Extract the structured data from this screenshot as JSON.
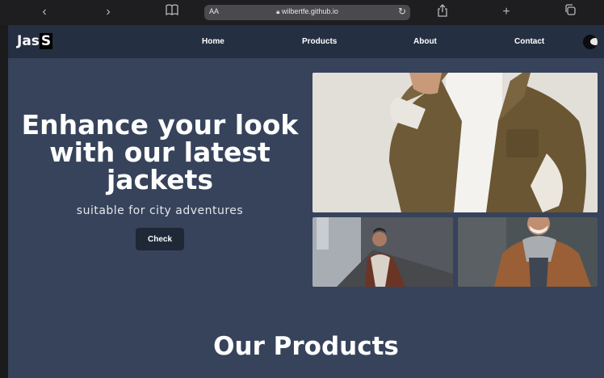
{
  "browser": {
    "url": "wilbertfe.github.io",
    "aa_label": "AA",
    "icons": [
      "back-icon",
      "forward-icon",
      "bookmarks-icon",
      "reload-icon",
      "share-icon",
      "new-tab-icon",
      "tabs-icon"
    ]
  },
  "site": {
    "logo_main": "Jas",
    "logo_accent": "S",
    "nav": {
      "home": "Home",
      "products": "Products",
      "about": "About",
      "contact": "Contact"
    },
    "hero": {
      "title_line1": "Enhance your look",
      "title_line2": "with our latest",
      "title_line3": "jackets",
      "subtitle": "suitable for city adventures",
      "cta": "Check"
    },
    "products_heading": "Our Products"
  },
  "colors": {
    "page_bg": "#36435b",
    "nav_bg": "#252f42",
    "button_bg": "#1f2836"
  }
}
